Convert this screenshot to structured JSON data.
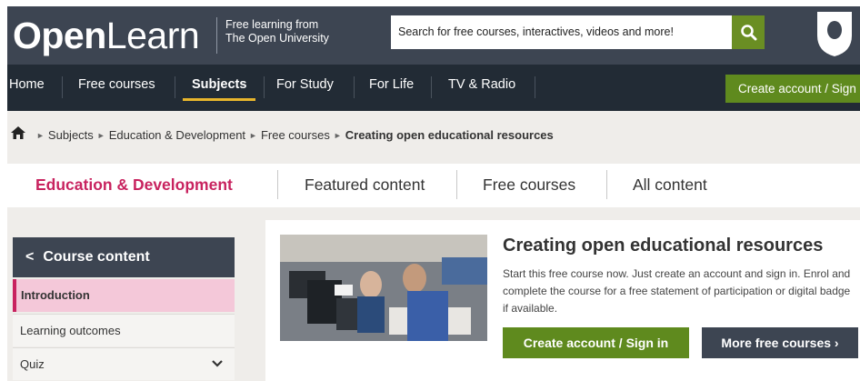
{
  "header": {
    "logo_bold": "Open",
    "logo_regular": "Learn",
    "tagline_line1": "Free learning from",
    "tagline_line2": "The Open University",
    "search_placeholder": "Search for free courses, interactives, videos and more!"
  },
  "nav": {
    "items": [
      {
        "label": "Home"
      },
      {
        "label": "Free courses"
      },
      {
        "label": "Subjects",
        "active": true
      },
      {
        "label": "For Study"
      },
      {
        "label": "For Life"
      },
      {
        "label": "TV & Radio"
      }
    ],
    "create_account_label": "Create account / Sign in"
  },
  "breadcrumb": {
    "items": [
      "Subjects",
      "Education & Development",
      "Free courses"
    ],
    "current": "Creating open educational resources"
  },
  "tabs": [
    {
      "label": "Education & Development",
      "active": true
    },
    {
      "label": "Featured content"
    },
    {
      "label": "Free courses"
    },
    {
      "label": "All content"
    }
  ],
  "sidebar": {
    "heading": "Course content",
    "items": [
      {
        "label": "Introduction",
        "active": true
      },
      {
        "label": "Learning outcomes"
      },
      {
        "label": "Quiz"
      }
    ]
  },
  "course": {
    "title": "Creating open educational resources",
    "description": "Start this free course now. Just create an account and sign in. Enrol and complete the course for a free statement of participation or digital badge if available.",
    "primary_button": "Create account / Sign in",
    "secondary_button": "More free courses ›"
  },
  "colors": {
    "header_bg": "#3d4552",
    "nav_bg": "#222b35",
    "accent_green": "#5f8a1e",
    "accent_pink": "#c8235f",
    "nav_active_underline": "#e7b52c"
  }
}
